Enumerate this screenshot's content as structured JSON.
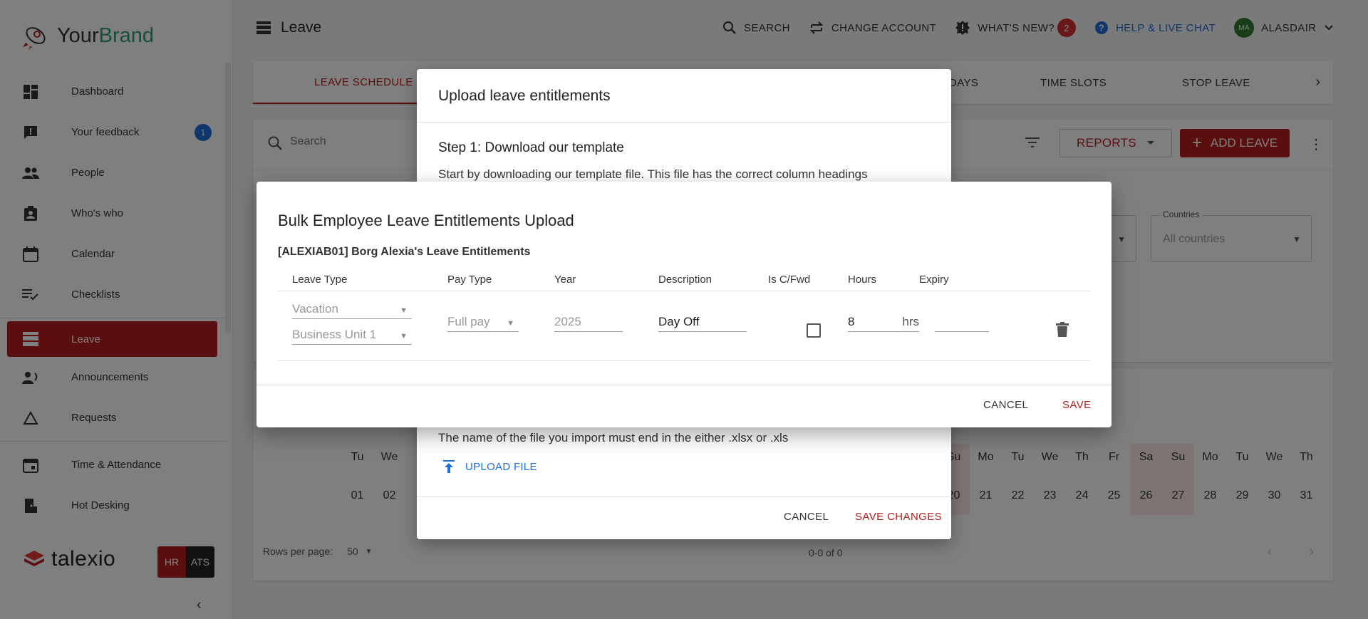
{
  "brand": {
    "name_part1": "Your",
    "name_part2": "Brand",
    "accent": "#2e9e7c"
  },
  "sidebar": {
    "items": [
      {
        "label": "Dashboard",
        "icon": "dashboard-icon"
      },
      {
        "label": "Your feedback",
        "icon": "feedback-icon",
        "badge": "1"
      },
      {
        "label": "People",
        "icon": "people-icon"
      },
      {
        "label": "Who's who",
        "icon": "contact-badge-icon"
      },
      {
        "label": "Calendar",
        "icon": "calendar-icon"
      },
      {
        "label": "Checklists",
        "icon": "checklist-icon"
      },
      {
        "label": "Leave",
        "icon": "leave-icon",
        "active": true
      },
      {
        "label": "Announcements",
        "icon": "announcement-icon"
      },
      {
        "label": "Requests",
        "icon": "request-triangle-icon"
      },
      {
        "label": "Time & Attendance",
        "icon": "event-icon"
      },
      {
        "label": "Hot Desking",
        "icon": "door-icon"
      }
    ],
    "footer_brand": "talexio",
    "hr_label": "HR",
    "ats_label": "ATS",
    "accent": "#b71c1c"
  },
  "header": {
    "title": "Leave",
    "search_label": "SEARCH",
    "change_account_label": "CHANGE ACCOUNT",
    "whats_new_label": "WHAT'S NEW?",
    "whats_new_count": "2",
    "help_label": "HELP & LIVE CHAT",
    "avatar_initials": "MA",
    "user_name": "ALASDAIR"
  },
  "tabs": [
    {
      "label": "LEAVE SCHEDULE",
      "active": true
    },
    {
      "label": "DAYS"
    },
    {
      "label": "TIME SLOTS"
    },
    {
      "label": "STOP LEAVE"
    }
  ],
  "toolbar": {
    "search_placeholder": "Search",
    "reports_label": "REPORTS",
    "add_leave_label": "ADD LEAVE"
  },
  "filters": {
    "countries_label": "Countries",
    "countries_value": "All countries"
  },
  "calendar": {
    "left_days": [
      {
        "dn": "Tu",
        "dd": "01"
      },
      {
        "dn": "We",
        "dd": "02"
      }
    ],
    "right_days": [
      {
        "dn": "Su",
        "dd": "20",
        "weekend": true
      },
      {
        "dn": "Mo",
        "dd": "21"
      },
      {
        "dn": "Tu",
        "dd": "22"
      },
      {
        "dn": "We",
        "dd": "23"
      },
      {
        "dn": "Th",
        "dd": "24"
      },
      {
        "dn": "Fr",
        "dd": "25"
      },
      {
        "dn": "Sa",
        "dd": "26",
        "weekend": true
      },
      {
        "dn": "Su",
        "dd": "27",
        "weekend": true
      },
      {
        "dn": "Mo",
        "dd": "28"
      },
      {
        "dn": "Tu",
        "dd": "29"
      },
      {
        "dn": "We",
        "dd": "30"
      },
      {
        "dn": "Th",
        "dd": "31"
      }
    ],
    "rows_per_page_label": "Rows per page:",
    "rows_per_page_value": "50",
    "pager_info": "0-0 of 0"
  },
  "upload_modal": {
    "title": "Upload leave entitlements",
    "step1": "Step 1: Download our template",
    "step1_text": "Start by downloading our template file. This file has the correct column headings",
    "file_note": "The name of the file you import must end in the either .xlsx or .xls",
    "upload_label": "UPLOAD FILE",
    "cancel_label": "CANCEL",
    "save_label": "SAVE CHANGES"
  },
  "bulk_modal": {
    "title": "Bulk Employee Leave Entitlements Upload",
    "subtitle": "[ALEXIAB01] Borg Alexia's Leave Entitlements",
    "headers": {
      "leave_type": "Leave Type",
      "pay_type": "Pay Type",
      "year": "Year",
      "description": "Description",
      "is_cfwd": "Is C/Fwd",
      "hours": "Hours",
      "expiry": "Expiry"
    },
    "row": {
      "leave_type": "Vacation",
      "business_unit": "Business Unit 1",
      "pay_type": "Full pay",
      "year": "2025",
      "description": "Day Off",
      "is_cfwd": false,
      "hours": "8",
      "hours_suffix": "hrs",
      "expiry": ""
    },
    "cancel_label": "CANCEL",
    "save_label": "SAVE"
  }
}
